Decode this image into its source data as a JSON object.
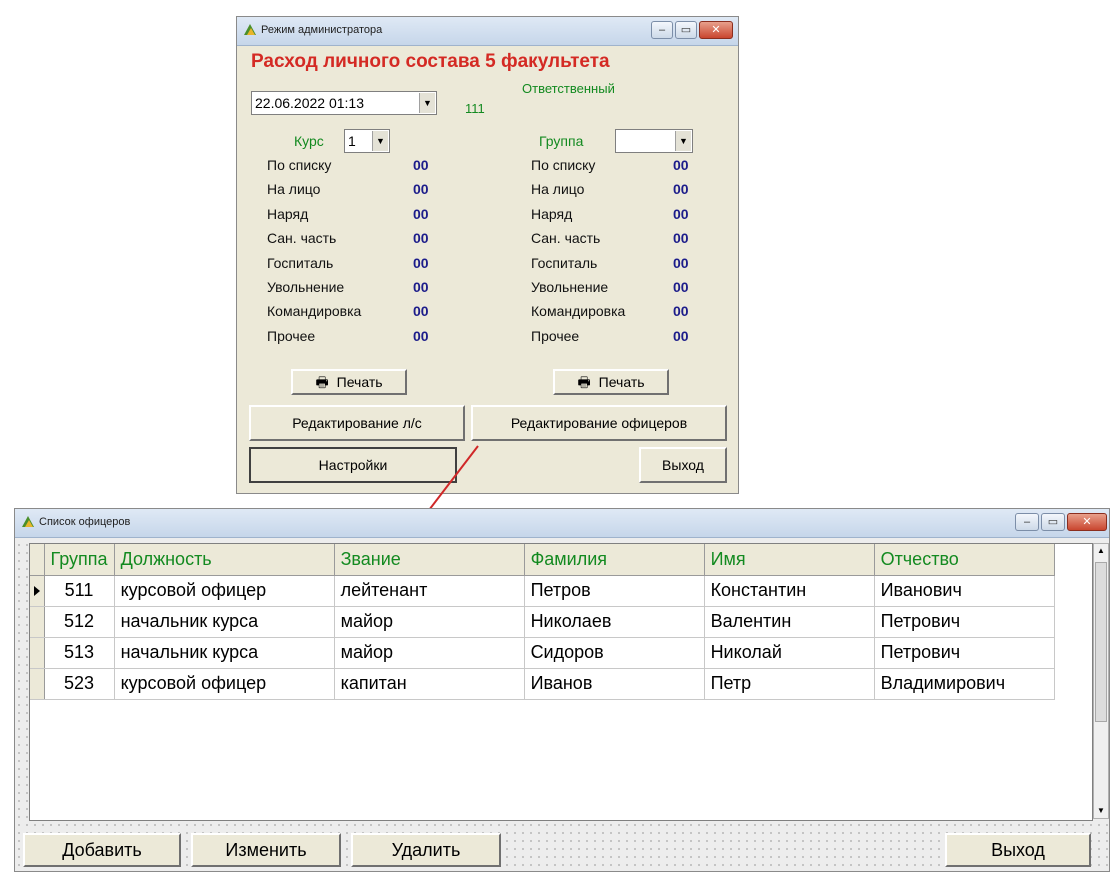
{
  "admin_window": {
    "title": "Режим администратора",
    "header": "Расход личного состава 5 факультета",
    "datetime": "22.06.2022 01:13",
    "responsible_label": "Ответственный",
    "responsible_value": "111",
    "course_label": "Курс",
    "course_value": "1",
    "group_label": "Группа",
    "group_value": "",
    "stats_labels": [
      "По списку",
      "На лицо",
      "Наряд",
      "Сан. часть",
      "Госпиталь",
      "Увольнение",
      "Командировка",
      "Прочее"
    ],
    "course_values": [
      "00",
      "00",
      "00",
      "00",
      "00",
      "00",
      "00",
      "00"
    ],
    "group_values": [
      "00",
      "00",
      "00",
      "00",
      "00",
      "00",
      "00",
      "00"
    ],
    "print_label": "Печать",
    "edit_personnel": "Редактирование л/с",
    "edit_officers": "Редактирование офицеров",
    "settings": "Настройки",
    "exit": "Выход"
  },
  "officers_window": {
    "title": "Список офицеров",
    "columns": [
      "Группа",
      "Должность",
      "Звание",
      "Фамилия",
      "Имя",
      "Отчество"
    ],
    "rows": [
      [
        "511",
        "курсовой офицер",
        "лейтенант",
        "Петров",
        "Константин",
        "Иванович"
      ],
      [
        "512",
        "начальник курса",
        "майор",
        "Николаев",
        "Валентин",
        "Петрович"
      ],
      [
        "513",
        "начальник курса",
        "майор",
        "Сидоров",
        "Николай",
        "Петрович"
      ],
      [
        "523",
        "курсовой офицер",
        "капитан",
        "Иванов",
        "Петр",
        "Владимирович"
      ]
    ],
    "add": "Добавить",
    "edit": "Изменить",
    "delete": "Удалить",
    "exit": "Выход"
  },
  "colors": {
    "header_red": "#d42a24",
    "label_green": "#138a20",
    "value_blue": "#1c1c8a",
    "arrow": "#d02828"
  },
  "icons": [
    "app-icon",
    "printer-icon",
    "minimize-icon",
    "maximize-icon",
    "close-icon",
    "row-pointer-icon",
    "scroll-up-icon",
    "scroll-down-icon"
  ]
}
